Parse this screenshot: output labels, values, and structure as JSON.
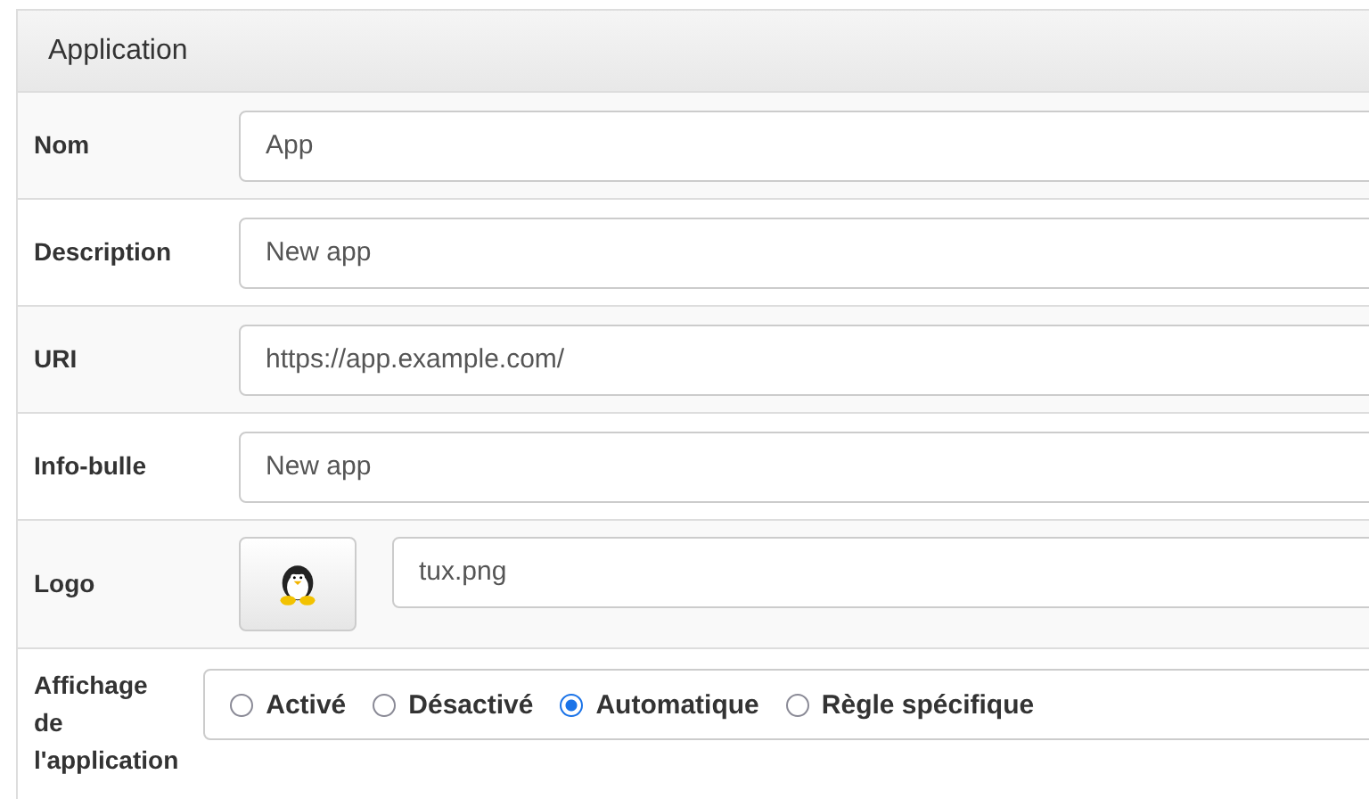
{
  "panel": {
    "title": "Application"
  },
  "rows": [
    {
      "kind": "text",
      "label": "Nom",
      "value": "App"
    },
    {
      "kind": "text",
      "label": "Description",
      "value": "New app"
    },
    {
      "kind": "text",
      "label": "URI",
      "value": "https://app.example.com/"
    },
    {
      "kind": "text",
      "label": "Info-bulle",
      "value": "New app"
    },
    {
      "kind": "logo",
      "label": "Logo",
      "value": "tux.png"
    },
    {
      "kind": "radio",
      "label": "Affichage de l'application",
      "options": [
        {
          "label": "Activé",
          "selected": false
        },
        {
          "label": "Désactivé",
          "selected": false
        },
        {
          "label": "Automatique",
          "selected": true
        },
        {
          "label": "Règle spécifique",
          "selected": false
        }
      ]
    }
  ]
}
